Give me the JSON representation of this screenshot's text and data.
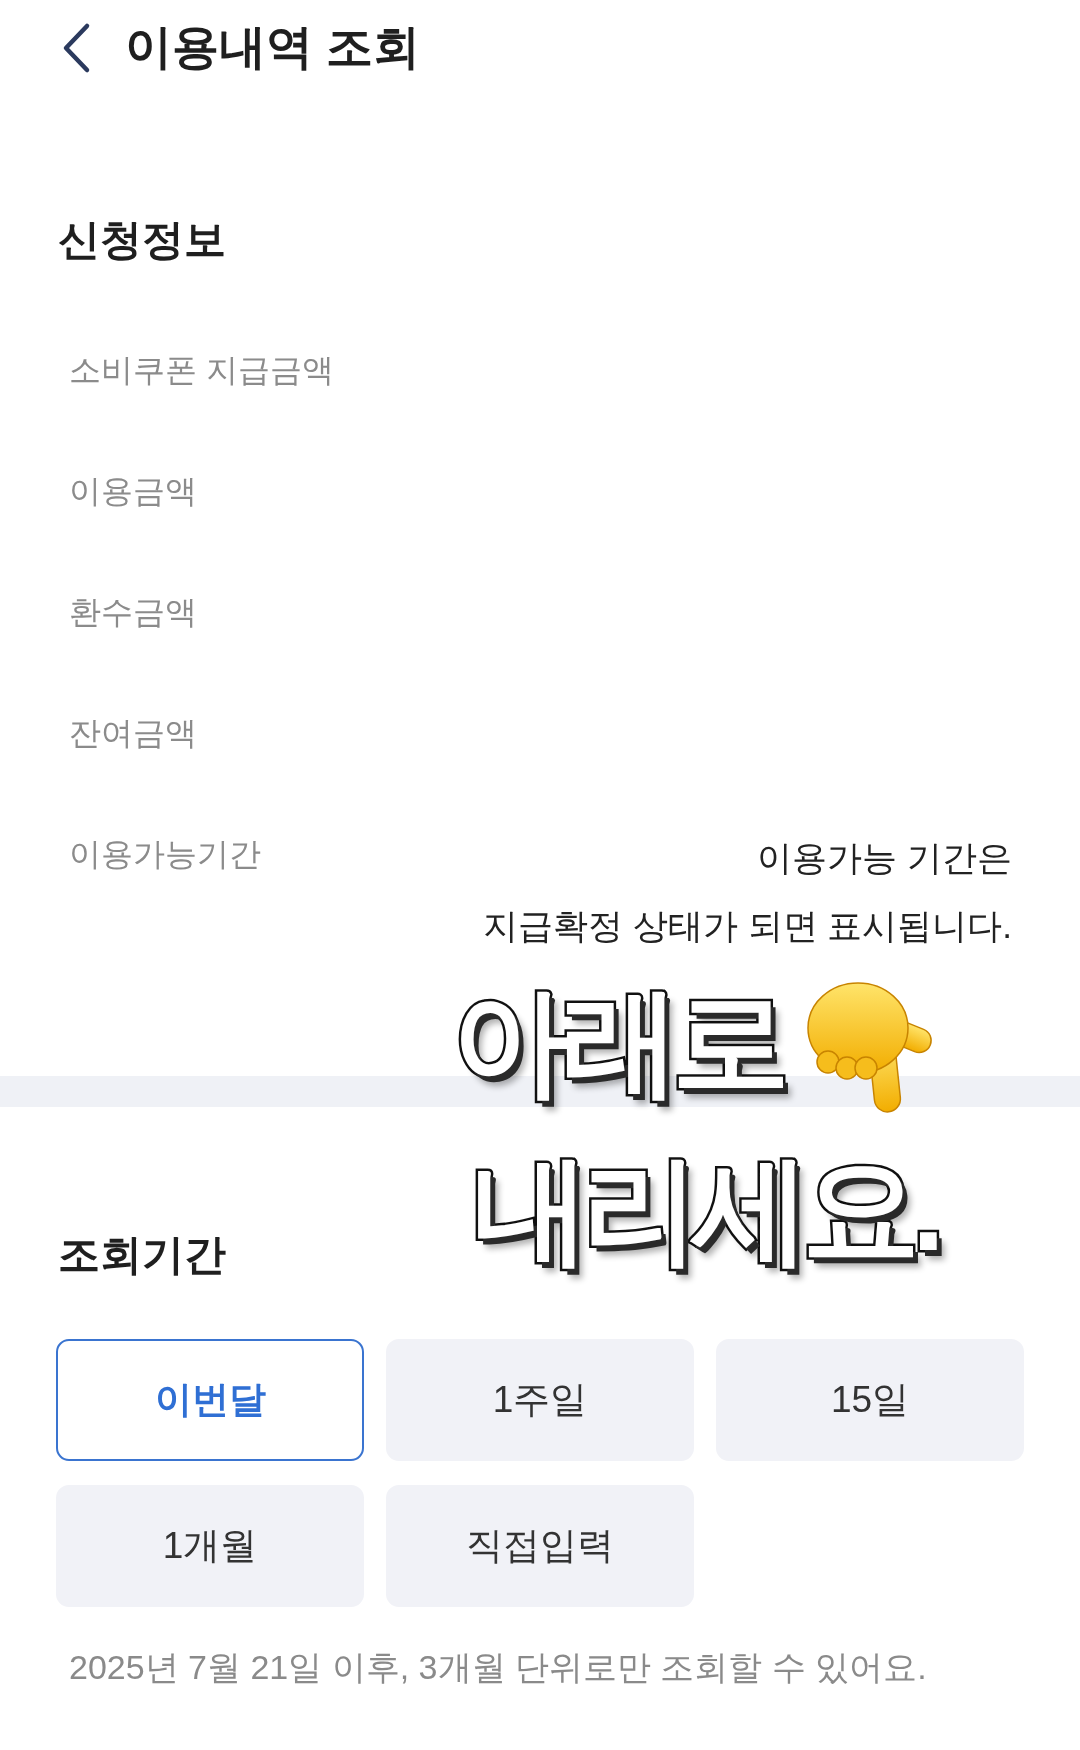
{
  "header": {
    "title": "이용내역 조회"
  },
  "application_info": {
    "heading": "신청정보",
    "rows": [
      {
        "label": "소비쿠폰 지급금액"
      },
      {
        "label": "이용금액"
      },
      {
        "label": "환수금액"
      },
      {
        "label": "잔여금액"
      },
      {
        "label": "이용가능기간",
        "value_lines": [
          "이용가능 기간은",
          "지급확정 상태가 되면 표시됩니다."
        ]
      }
    ]
  },
  "period": {
    "heading": "조회기간",
    "options": [
      {
        "label": "이번달",
        "selected": true
      },
      {
        "label": "1주일",
        "selected": false
      },
      {
        "label": "15일",
        "selected": false
      },
      {
        "label": "1개월",
        "selected": false
      },
      {
        "label": "직접입력",
        "selected": false
      }
    ],
    "notice": "2025년 7월 21일 이후, 3개월 단위로만 조회할 수 있어요."
  },
  "overlay_caption": {
    "lines": [
      "아래로",
      "내리세요."
    ]
  }
}
